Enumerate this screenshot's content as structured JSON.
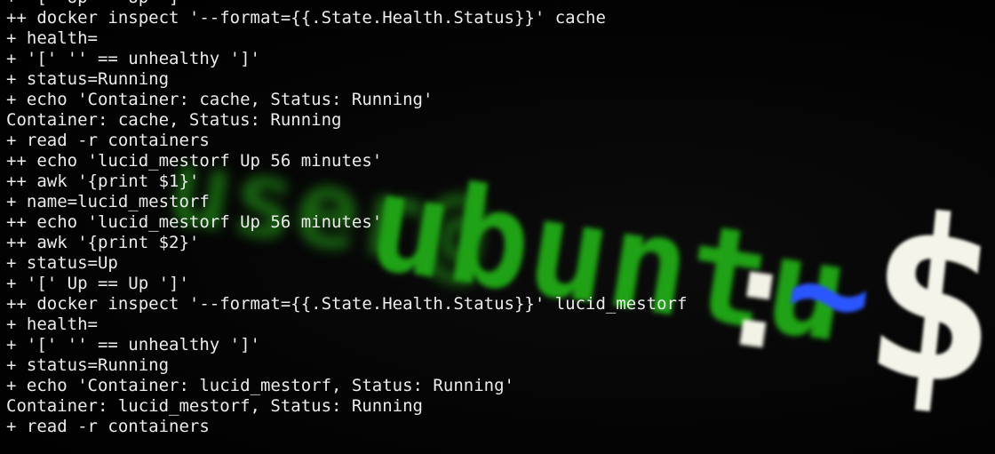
{
  "background_prompt": {
    "user": "user@",
    "host": "ubuntu",
    "colon": ":",
    "tilde": "~",
    "dollar": "$"
  },
  "terminal": {
    "lines": [
      "+ '[' Up == Up ']'",
      "++ docker inspect '--format={{.State.Health.Status}}' cache",
      "+ health=",
      "+ '[' '' == unhealthy ']'",
      "+ status=Running",
      "+ echo 'Container: cache, Status: Running'",
      "Container: cache, Status: Running",
      "+ read -r containers",
      "++ echo 'lucid_mestorf Up 56 minutes'",
      "++ awk '{print $1}'",
      "+ name=lucid_mestorf",
      "++ echo 'lucid_mestorf Up 56 minutes'",
      "++ awk '{print $2}'",
      "+ status=Up",
      "+ '[' Up == Up ']'",
      "++ docker inspect '--format={{.State.Health.Status}}' lucid_mestorf",
      "+ health=",
      "+ '[' '' == unhealthy ']'",
      "+ status=Running",
      "+ echo 'Container: lucid_mestorf, Status: Running'",
      "Container: lucid_mestorf, Status: Running",
      "+ read -r containers"
    ]
  },
  "colors": {
    "background": "#030303",
    "text": "#ececec",
    "prompt_green": "#1fa215",
    "prompt_blue": "#2a56ff",
    "prompt_white": "#f4f4ea"
  }
}
